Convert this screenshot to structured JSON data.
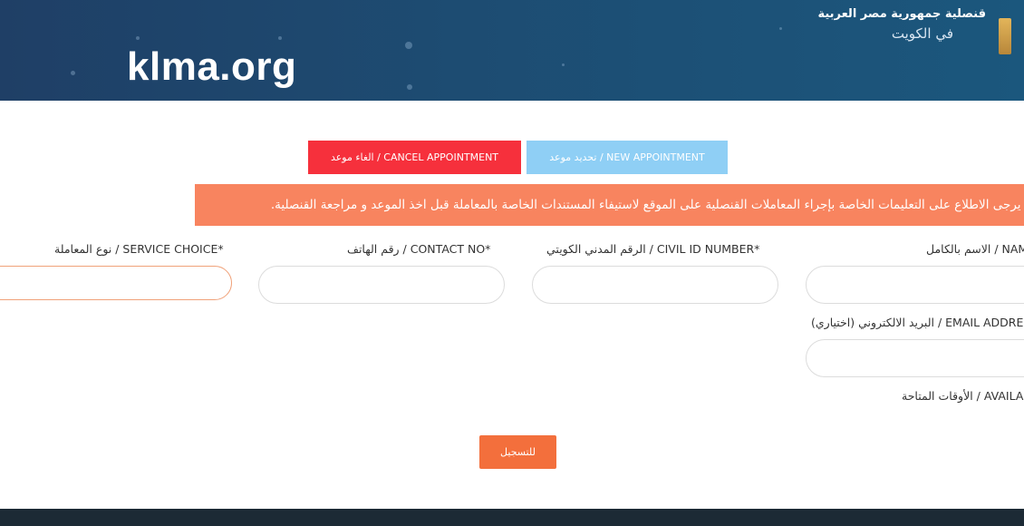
{
  "header": {
    "watermark": "klma.org",
    "brand_line1": "قنصلية جمهورية مصر العربية",
    "brand_line2": "في الكويت"
  },
  "actions": {
    "cancel_label": "الغاء موعد / CANCEL APPOINTMENT",
    "new_label": "تحديد موعد / NEW APPOINTMENT"
  },
  "notice": {
    "text": "هام: يرجى الاطلاع على التعليمات الخاصة بإجراء المعاملات القنصلية على الموقع لاستيفاء المستندات الخاصة بالمعاملة قبل اخذ الموعد و مراجعة القنصلية."
  },
  "form": {
    "service_label": "نوع المعاملة / SERVICE CHOICE*",
    "contact_label": "رقم الهاتف / CONTACT NO*",
    "civil_id_label": "الرقم المدني الكويتي / CIVIL ID NUMBER*",
    "name_label": "الاسم بالكامل / NAME*",
    "email_label": "البريد الالكتروني (اختياري) / EMAIL ADDRESS",
    "times_label": "الأوقات المتاحة / AVAILABLE TIMES",
    "submit_label": "للتسجيل"
  },
  "colors": {
    "header": "#1d4c72",
    "cancel_button": "#f6303c",
    "new_button": "#8fcff5",
    "notice": "#f8845f",
    "submit": "#f36f3c",
    "footer": "#1c2a35"
  }
}
